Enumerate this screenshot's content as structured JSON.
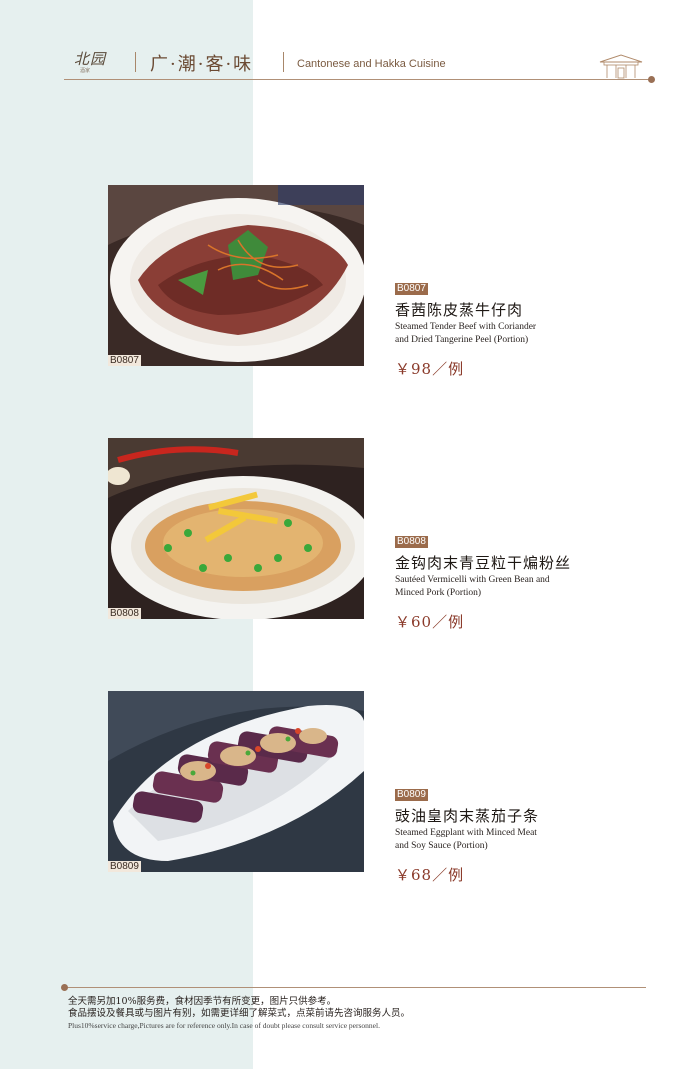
{
  "header": {
    "logo_text": "北园",
    "logo_sub": "酒家",
    "title_cn": "广·潮·客·味",
    "title_en": "Cantonese and Hakka Cuisine"
  },
  "items": [
    {
      "code": "B0807",
      "name_cn": "香茜陈皮蒸牛仔肉",
      "name_en_1": "Steamed Tender Beef with Coriander",
      "name_en_2": "and Dried Tangerine Peel  (Portion)",
      "price": "￥98／例"
    },
    {
      "code": "B0808",
      "name_cn": "金钩肉末青豆粒干煸粉丝",
      "name_en_1": "Sautéed Vermicelli with Green Bean and",
      "name_en_2": "Minced Pork   (Portion)",
      "price": "￥60／例"
    },
    {
      "code": "B0809",
      "name_cn": "豉油皇肉末蒸茄子条",
      "name_en_1": "Steamed Eggplant with Minced Meat",
      "name_en_2": "and Soy Sauce   (Portion)",
      "price": "￥68／例"
    }
  ],
  "footer": {
    "line1": "全天需另加10%服务费，食材因季节有所变更，图片只供参考。",
    "line2": "食品摆设及餐具或与图片有别，如需更详细了解菜式，点菜前请先咨询服务人员。",
    "line3": "Plus10%service charge,Pictures are for reference only.In case of doubt please consult service personnel."
  },
  "colors": {
    "accent_brown": "#9b6b4b",
    "band_teal": "#e6f0ef",
    "price_red": "#8a3a2a"
  }
}
